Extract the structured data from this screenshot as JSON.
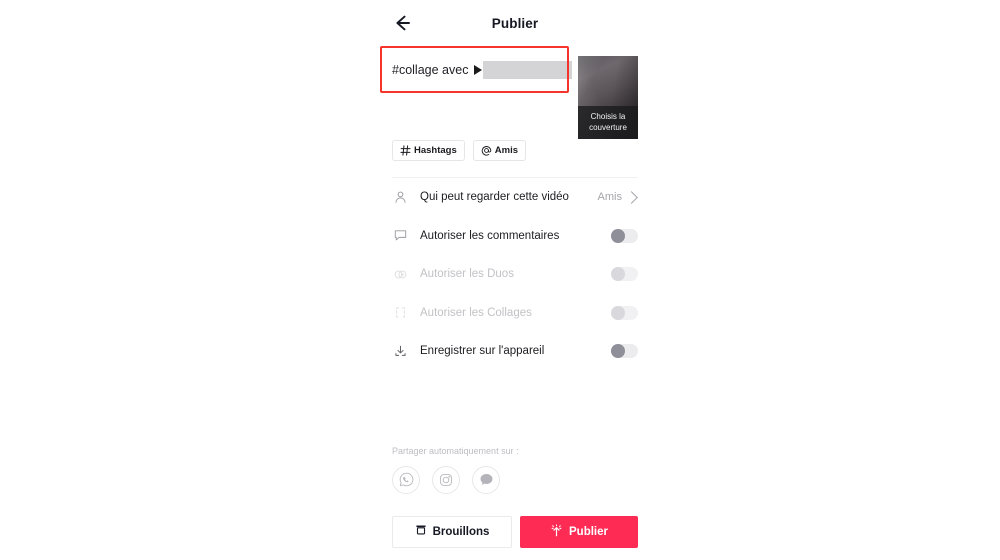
{
  "app": {
    "screen_title": "Publier",
    "back_icon": "back-arrow-icon"
  },
  "caption": {
    "text": "#collage avec",
    "mention_icon": "play-marker-icon",
    "mention_redacted": "",
    "caret_color": "#f2b705",
    "redaction_color": "#d4d4d6"
  },
  "cover": {
    "overlay_line1": "Choisis la",
    "overlay_line2": "couverture"
  },
  "chips": [
    {
      "icon": "hashtag-icon",
      "label": "Hashtags"
    },
    {
      "icon": "at-icon",
      "label": "Amis"
    }
  ],
  "settings": [
    {
      "icon": "person-icon",
      "label": "Qui peut regarder cette vidéo",
      "control": "value",
      "value": "Amis",
      "disabled": false
    },
    {
      "icon": "comment-icon",
      "label": "Autoriser les commentaires",
      "control": "toggle",
      "toggle_on": false,
      "disabled": false
    },
    {
      "icon": "duet-icon",
      "label": "Autoriser les Duos",
      "control": "toggle",
      "toggle_on": false,
      "disabled": true
    },
    {
      "icon": "stitch-icon",
      "label": "Autoriser les Collages",
      "control": "toggle",
      "toggle_on": false,
      "disabled": true
    },
    {
      "icon": "download-icon",
      "label": "Enregistrer sur l'appareil",
      "control": "toggle",
      "toggle_on": false,
      "disabled": false
    }
  ],
  "share": {
    "label": "Partager automatiquement sur :",
    "icons": [
      {
        "name": "whatsapp-icon"
      },
      {
        "name": "instagram-icon"
      },
      {
        "name": "message-bubble-icon"
      }
    ]
  },
  "footer": {
    "draft_label": "Brouillons",
    "draft_icon": "archive-box-icon",
    "publish_label": "Publier",
    "publish_icon": "publish-sparkle-icon",
    "publish_color": "#fe2c55"
  },
  "annotation": {
    "color": "#f5352b"
  }
}
